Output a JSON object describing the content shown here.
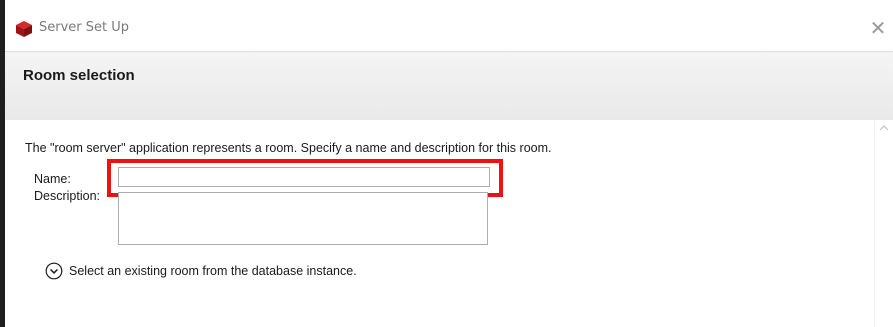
{
  "window": {
    "title": "Server Set Up",
    "app_icon": "red-cube-icon",
    "close_icon": "close-icon",
    "close_glyph": "✕"
  },
  "header": {
    "title": "Room selection"
  },
  "content": {
    "intro": "The \"room server\" application represents a room. Specify a name and description for this room.",
    "name_label": "Name:",
    "name_value": "",
    "description_label": "Description:",
    "description_value": "",
    "expander_label": "Select an existing room from the database instance.",
    "expander_icon": "chevron-down-circle-icon"
  },
  "colors": {
    "highlight": "#ee1111",
    "header_bg": "#ededed",
    "app_icon": "#b5121b"
  }
}
